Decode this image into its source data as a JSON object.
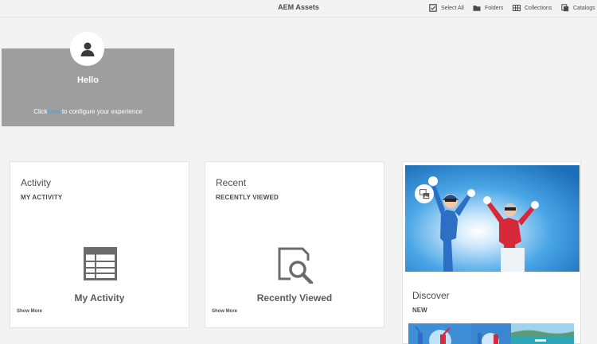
{
  "header": {
    "title": "AEM Assets",
    "actions": [
      {
        "label": "Select All",
        "icon": "select-all-icon"
      },
      {
        "label": "Folders",
        "icon": "folder-icon"
      },
      {
        "label": "Collections",
        "icon": "collections-icon"
      },
      {
        "label": "Catalogs",
        "icon": "catalogs-icon"
      }
    ]
  },
  "hello": {
    "icon": "user-icon",
    "title": "Hello",
    "line_before": "Click",
    "line_link": "here",
    "line_after": "to configure your experience"
  },
  "cards": [
    {
      "title": "Activity",
      "subtitle": "MY ACTIVITY",
      "icon": "table-icon",
      "label": "My Activity",
      "more": "Show More"
    },
    {
      "title": "Recent",
      "subtitle": "RECENTLY VIEWED",
      "icon": "search-document-icon",
      "label": "Recently Viewed",
      "more": "Show More"
    }
  ],
  "discover": {
    "title": "Discover",
    "subtitle": "NEW",
    "badge_icon": "image-collection-icon",
    "image": "skiers-jumping-photo",
    "thumbnails": [
      "skiers-thumbnail",
      "skiers-thumbnail",
      "beach-thumbnail"
    ]
  },
  "colors": {
    "background": "#f3f3f3",
    "hello_panel": "#9e9e9e",
    "link": "#4aa3e0",
    "text": "#4b4b4b"
  }
}
